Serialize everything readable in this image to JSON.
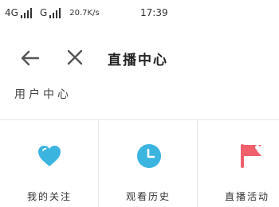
{
  "status_bar": {
    "network_1": "4G",
    "network_2": "G",
    "speed": "20.7K/s",
    "time": "17:39"
  },
  "toolbar": {
    "back_icon": "arrow-left-icon",
    "close_icon": "close-icon",
    "title": "直播中心"
  },
  "section": {
    "label": "用户中心"
  },
  "grid": {
    "items": [
      {
        "label": "我的关注",
        "icon": "heart-icon",
        "color": "#3bb4e0"
      },
      {
        "label": "观看历史",
        "icon": "clock-icon",
        "color": "#3bb4e0"
      },
      {
        "label": "直播活动",
        "icon": "flag-icon",
        "color": "#f0606c"
      }
    ]
  },
  "colors": {
    "accent_blue": "#3bb4e0",
    "accent_red": "#f0606c",
    "divider": "#e6e6e6"
  }
}
